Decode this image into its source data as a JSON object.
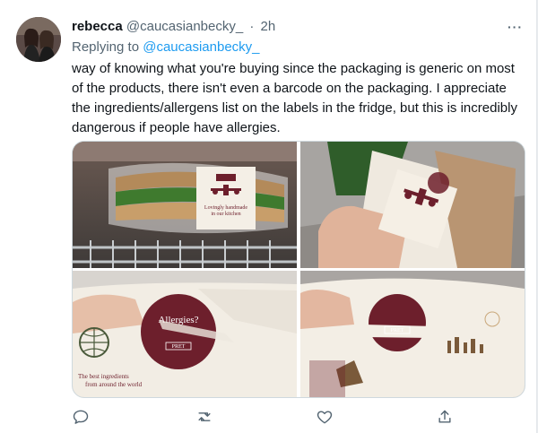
{
  "tweet": {
    "display_name": "rebecca",
    "handle": "@caucasianbecky_",
    "separator": "·",
    "time": "2h",
    "more_label": "···",
    "replying_prefix": "Replying to",
    "replying_handle": "@caucasianbecky_",
    "body": "way of knowing what you're buying since the packaging is generic on most of the products, there isn't even a barcode on the packaging. I appreciate the ingredients/allergens list on the labels in the fridge, but this is incredibly dangerous if people have allergies."
  },
  "media": {
    "photo1": {
      "label_line1": "Lovingly handmade",
      "label_line2": "in our kitchen"
    },
    "photo3": {
      "circle_title": "Allergies?",
      "bottom_text_1": "The best ingredients",
      "bottom_text_2": "from around the world",
      "logo": "PRET"
    },
    "photo4": {
      "logo": "PRET"
    }
  },
  "actions": {
    "reply_icon": "comment-icon",
    "retweet_icon": "retweet-icon",
    "like_icon": "heart-icon",
    "share_icon": "share-icon"
  },
  "colors": {
    "accent": "#1d9bf0",
    "label_burgundy": "#6d1f2c",
    "text_primary": "#0f1419",
    "text_secondary": "#536471"
  }
}
